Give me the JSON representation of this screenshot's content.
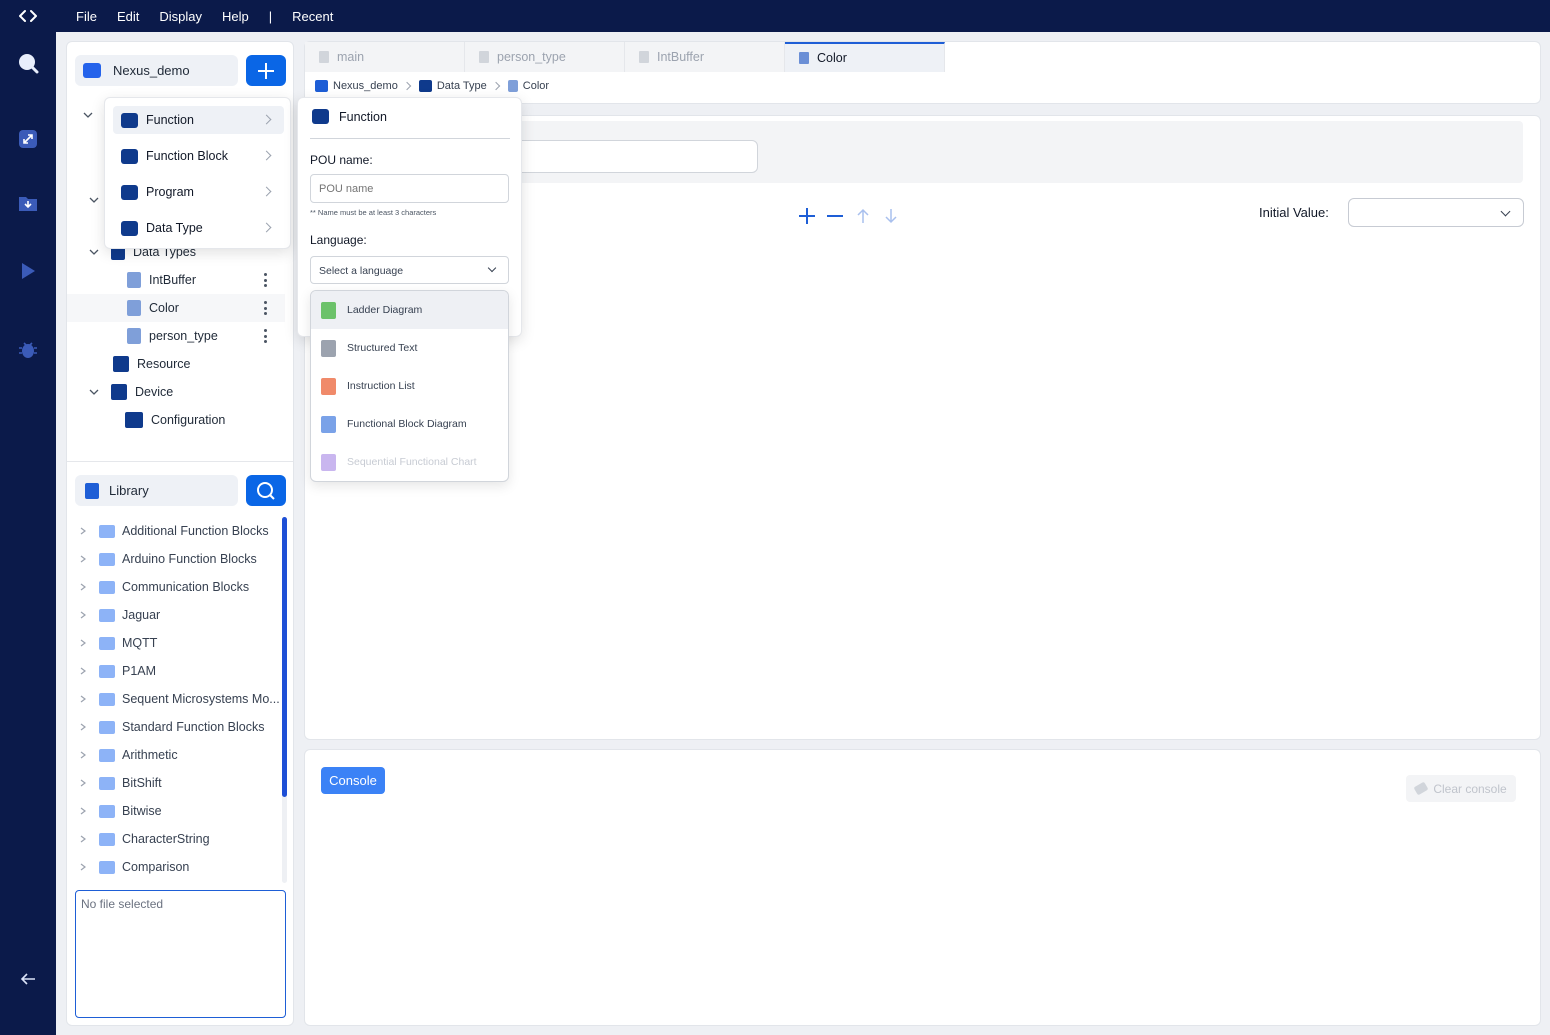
{
  "menubar": {
    "items": [
      "File",
      "Edit",
      "Display",
      "Help",
      "|",
      "Recent"
    ]
  },
  "explorer": {
    "project_name": "Nexus_demo",
    "tree": {
      "data_types_label": "Data Types",
      "data_types": [
        "IntBuffer",
        "Color",
        "person_type"
      ],
      "resource": "Resource",
      "device": "Device",
      "configuration": "Configuration"
    },
    "library": {
      "title": "Library",
      "items": [
        "Additional Function Blocks",
        "Arduino Function Blocks",
        "Communication Blocks",
        "Jaguar",
        "MQTT",
        "P1AM",
        "Sequent Microsystems Mo...",
        "Standard Function Blocks",
        "Arithmetic",
        "BitShift",
        "Bitwise",
        "CharacterString",
        "Comparison"
      ]
    },
    "file_info": "No file selected"
  },
  "tabs": [
    "main",
    "person_type",
    "IntBuffer",
    "Color"
  ],
  "active_tab": "Color",
  "breadcrumb": [
    "Nexus_demo",
    "Data Type",
    "Color"
  ],
  "editor": {
    "initial_value_label": "Initial Value:"
  },
  "console": {
    "button_label": "Console",
    "clear_label": "Clear console"
  },
  "add_menu": {
    "items": [
      "Function",
      "Function Block",
      "Program",
      "Data Type"
    ],
    "selected": "Function"
  },
  "pou_form": {
    "title": "Function",
    "name_label": "POU name:",
    "name_placeholder": "POU name",
    "name_hint": "** Name must be at least 3 characters",
    "language_label": "Language:",
    "language_placeholder": "Select a language",
    "languages": [
      {
        "label": "Ladder Diagram",
        "color": "#6cc26a",
        "enabled": true
      },
      {
        "label": "Structured Text",
        "color": "#9ca3af",
        "enabled": true
      },
      {
        "label": "Instruction List",
        "color": "#f08a6a",
        "enabled": true
      },
      {
        "label": "Functional Block Diagram",
        "color": "#7aa2e8",
        "enabled": true
      },
      {
        "label": "Sequential Functional Chart",
        "color": "#c9b6ef",
        "enabled": false
      }
    ]
  },
  "colors": {
    "sidebar_bg": "#0b1a4a",
    "accent": "#0a66e6",
    "console_button": "#3b82f6"
  }
}
